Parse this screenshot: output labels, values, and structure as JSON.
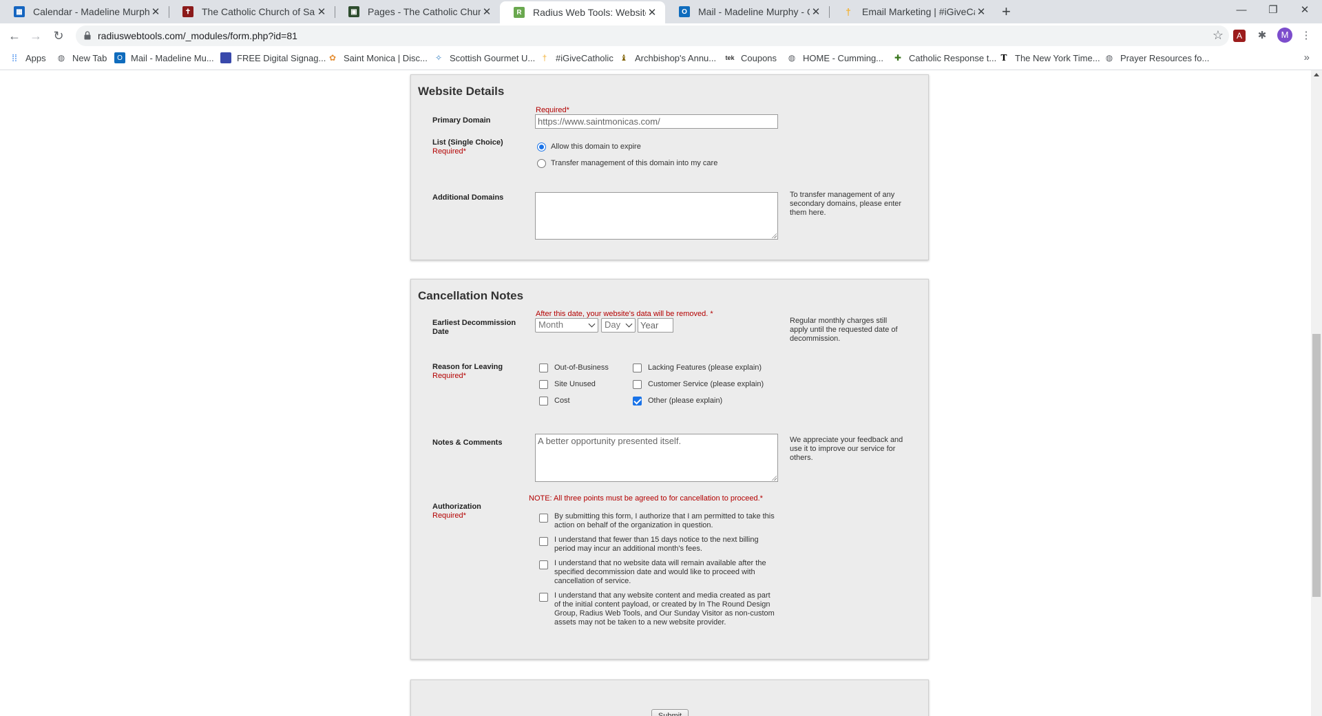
{
  "tabs": [
    {
      "title": "Calendar - Madeline Murphy - Ou",
      "favicon": "calendar-icon",
      "color": "#1565c0"
    },
    {
      "title": "The Catholic Church of Saint Mo",
      "favicon": "church-cross-icon",
      "color": "#8b1a1a"
    },
    {
      "title": "Pages - The Catholic Church of S",
      "favicon": "pages-icon",
      "color": "#2e4d2e"
    },
    {
      "title": "Radius Web Tools: Website Cance",
      "favicon": "radius-icon",
      "color": "#6aa84f"
    },
    {
      "title": "Mail - Madeline Murphy - Outloo",
      "favicon": "outlook-icon",
      "color": "#0f6cbd"
    },
    {
      "title": "Email Marketing | #iGiveCatholic",
      "favicon": "candle-icon",
      "color": "#f2b134"
    }
  ],
  "address": {
    "url": "radiuswebtools.com/_modules/form.php?id=81"
  },
  "profile": {
    "initial": "M"
  },
  "bookmarks": [
    {
      "label": "Apps",
      "icon": "apps-grid-icon"
    },
    {
      "label": "New Tab",
      "icon": "globe-icon"
    },
    {
      "label": "Mail - Madeline Mu...",
      "icon": "outlook-icon"
    },
    {
      "label": "FREE Digital Signag...",
      "icon": "signage-icon"
    },
    {
      "label": "Saint Monica | Disc...",
      "icon": "flower-icon"
    },
    {
      "label": "Scottish Gourmet U...",
      "icon": "scottish-icon"
    },
    {
      "label": "#iGiveCatholic",
      "icon": "candle-icon"
    },
    {
      "label": "Archbishop's Annu...",
      "icon": "archbishop-icon"
    },
    {
      "label": "Coupons",
      "icon": "coupons-icon"
    },
    {
      "label": "HOME - Cumming...",
      "icon": "globe-icon"
    },
    {
      "label": "Catholic Response t...",
      "icon": "catholic-response-icon"
    },
    {
      "label": "The New York Time...",
      "icon": "nyt-icon"
    },
    {
      "label": "Prayer Resources fo...",
      "icon": "globe-icon"
    }
  ],
  "website_details": {
    "title": "Website Details",
    "primary_domain": {
      "label": "Primary Domain",
      "required": "Required*",
      "value": "https://www.saintmonicas.com/"
    },
    "list_choice": {
      "label": "List (Single Choice)",
      "required": "Required*",
      "options": [
        {
          "label": "Allow this domain to expire",
          "selected": true
        },
        {
          "label": "Transfer management of this domain into my care",
          "selected": false
        }
      ]
    },
    "additional_domains": {
      "label": "Additional Domains",
      "value": "",
      "hint": "To transfer management of any secondary domains, please enter them here."
    }
  },
  "cancellation_notes": {
    "title": "Cancellation Notes",
    "decommission": {
      "label_line1": "Earliest Decommission",
      "label_line2": "Date",
      "note": "After this date, your website's data will be removed. *",
      "month": "Month",
      "day": "Day",
      "year_placeholder": "Year",
      "hint": "Regular monthly charges still apply until the requested date of decommission."
    },
    "reasons": {
      "label": "Reason for Leaving",
      "required": "Required*",
      "options": [
        {
          "label": "Out-of-Business",
          "checked": false
        },
        {
          "label": "Lacking Features (please explain)",
          "checked": false
        },
        {
          "label": "Site Unused",
          "checked": false
        },
        {
          "label": "Customer Service (please explain)",
          "checked": false
        },
        {
          "label": "Cost",
          "checked": false
        },
        {
          "label": "Other (please explain)",
          "checked": true
        }
      ]
    },
    "notes": {
      "label": "Notes & Comments",
      "value": "A better opportunity presented itself.",
      "hint": "We appreciate your feedback and use it to improve our service for others."
    },
    "authorization": {
      "label": "Authorization",
      "required": "Required*",
      "note": "NOTE: All three points must be agreed to for cancellation to proceed.*",
      "items": [
        {
          "text": "By submitting this form, I authorize that I am permitted to take this action on behalf of the organization in question.",
          "checked": false
        },
        {
          "text": "I understand that fewer than 15 days notice to the next billing period may incur an additional month's fees.",
          "checked": false
        },
        {
          "text": "I understand that no website data will remain available after the specified decommission date and would like to proceed with cancellation of service.",
          "checked": false
        },
        {
          "text": "I understand that any website content and media created as part of the initial content payload, or created by In The Round Design Group, Radius Web Tools, and Our Sunday Visitor as non-custom assets may not be taken to a new website provider.",
          "checked": false
        }
      ]
    }
  },
  "submit": {
    "label": "Submit"
  },
  "colors": {
    "accent": "#1a73e8",
    "required": "#b30000",
    "panel": "#ececec"
  }
}
